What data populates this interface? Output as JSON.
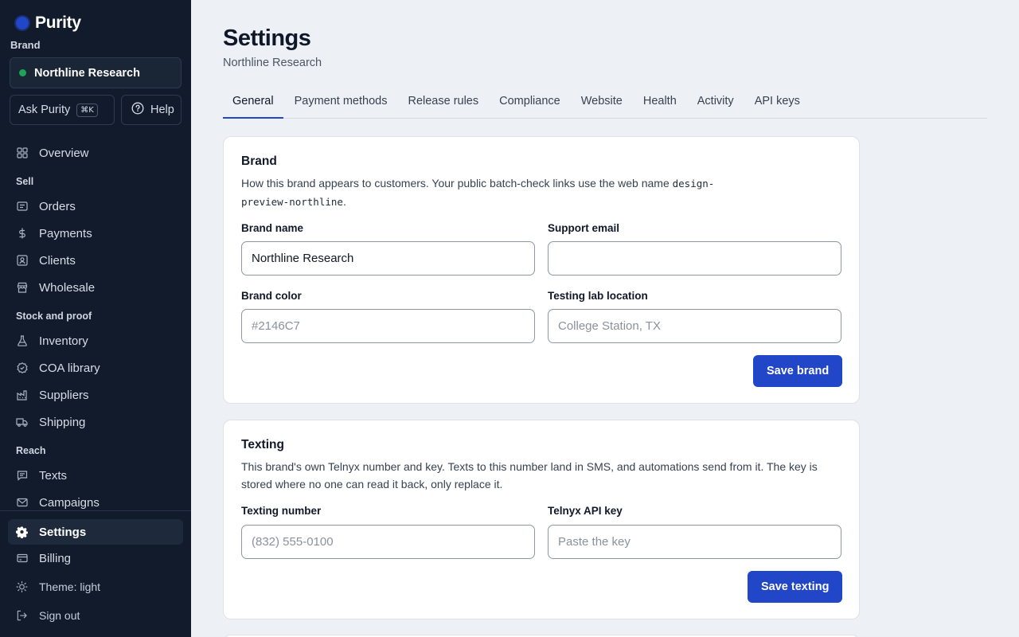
{
  "app": {
    "name": "Purity"
  },
  "sidebar": {
    "brand_label": "Brand",
    "brand_selected": "Northline Research",
    "ask_label": "Ask Purity",
    "ask_shortcut": "⌘K",
    "help_label": "Help",
    "overview": "Overview",
    "sections": {
      "sell": "Sell",
      "stock": "Stock and proof",
      "reach": "Reach"
    },
    "items": {
      "orders": "Orders",
      "payments": "Payments",
      "clients": "Clients",
      "wholesale": "Wholesale",
      "inventory": "Inventory",
      "coa": "COA library",
      "suppliers": "Suppliers",
      "shipping": "Shipping",
      "texts": "Texts",
      "campaigns": "Campaigns",
      "settings": "Settings",
      "billing": "Billing"
    },
    "theme": "Theme: light",
    "signout": "Sign out"
  },
  "page": {
    "title": "Settings",
    "subtitle": "Northline Research"
  },
  "tabs": [
    "General",
    "Payment methods",
    "Release rules",
    "Compliance",
    "Website",
    "Health",
    "Activity",
    "API keys"
  ],
  "brand_card": {
    "title": "Brand",
    "desc_prefix": "How this brand appears to customers. Your public batch-check links use the web name ",
    "desc_code1": "design-",
    "desc_code2": "preview-northline",
    "desc_suffix": ".",
    "brand_name_label": "Brand name",
    "brand_name_value": "Northline Research",
    "support_email_label": "Support email",
    "support_email_value": "",
    "brand_color_label": "Brand color",
    "brand_color_placeholder": "#2146C7",
    "lab_location_label": "Testing lab location",
    "lab_location_placeholder": "College Station, TX",
    "save_label": "Save brand"
  },
  "texting_card": {
    "title": "Texting",
    "desc": "This brand's own Telnyx number and key. Texts to this number land in SMS, and automations send from it. The key is stored where no one can read it back, only replace it.",
    "number_label": "Texting number",
    "number_placeholder": "(832) 555-0100",
    "key_label": "Telnyx API key",
    "key_placeholder": "Paste the key",
    "save_label": "Save texting"
  },
  "colors": {
    "accent": "#2146C7",
    "sidebar_bg": "#111B2B",
    "status_green": "#1FA35C"
  }
}
